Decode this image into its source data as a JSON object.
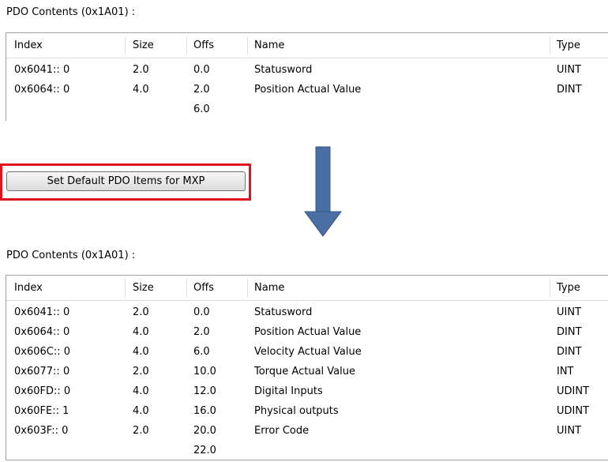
{
  "top": {
    "caption": "PDO Contents (0x1A01) :",
    "headers": {
      "index": "Index",
      "size": "Size",
      "offs": "Offs",
      "name": "Name",
      "type": "Type"
    },
    "rows": [
      {
        "index": "0x6041:: 0",
        "size": "2.0",
        "offs": "0.0",
        "name": "Statusword",
        "type": "UINT"
      },
      {
        "index": "0x6064:: 0",
        "size": "4.0",
        "offs": "2.0",
        "name": "Position Actual Value",
        "type": "DINT"
      },
      {
        "index": "",
        "size": "",
        "offs": "6.0",
        "name": "",
        "type": ""
      }
    ]
  },
  "button": {
    "label": "Set Default PDO Items for MXP"
  },
  "arrow": {
    "icon": "arrow-down-icon",
    "color": "#4a6fa5"
  },
  "bottom": {
    "caption": "PDO Contents (0x1A01) :",
    "headers": {
      "index": "Index",
      "size": "Size",
      "offs": "Offs",
      "name": "Name",
      "type": "Type"
    },
    "rows": [
      {
        "index": "0x6041:: 0",
        "size": "2.0",
        "offs": "0.0",
        "name": "Statusword",
        "type": "UINT"
      },
      {
        "index": "0x6064:: 0",
        "size": "4.0",
        "offs": "2.0",
        "name": "Position Actual Value",
        "type": "DINT"
      },
      {
        "index": "0x606C:: 0",
        "size": "4.0",
        "offs": "6.0",
        "name": "Velocity Actual Value",
        "type": "DINT"
      },
      {
        "index": "0x6077:: 0",
        "size": "2.0",
        "offs": "10.0",
        "name": "Torque Actual Value",
        "type": "INT"
      },
      {
        "index": "0x60FD:: 0",
        "size": "4.0",
        "offs": "12.0",
        "name": "Digital Inputs",
        "type": "UDINT"
      },
      {
        "index": "0x60FE:: 1",
        "size": "4.0",
        "offs": "16.0",
        "name": "Physical outputs",
        "type": "UDINT"
      },
      {
        "index": "0x603F:: 0",
        "size": "2.0",
        "offs": "20.0",
        "name": "Error Code",
        "type": "UINT"
      },
      {
        "index": "",
        "size": "",
        "offs": "22.0",
        "name": "",
        "type": ""
      }
    ]
  }
}
